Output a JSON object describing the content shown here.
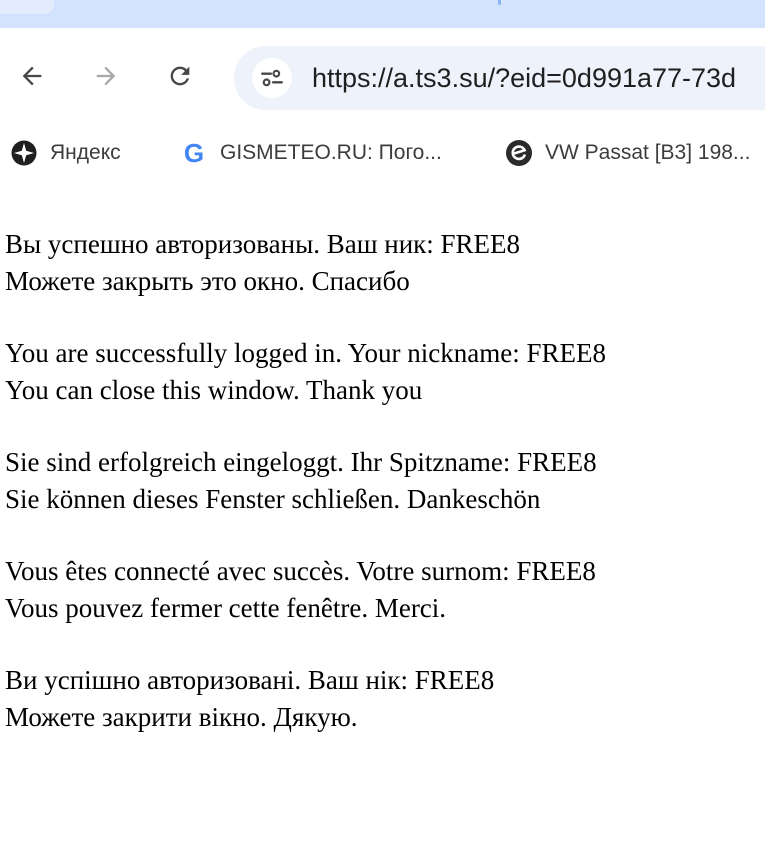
{
  "browser": {
    "url": "https://a.ts3.su/?eid=0d991a77-73d",
    "icons": {
      "back": "back-arrow-icon",
      "forward": "forward-arrow-icon",
      "reload": "reload-icon",
      "site_info": "site-settings-icon"
    },
    "colors": {
      "tabstrip": "#d3e3fd",
      "omnibox": "#eef2fa"
    }
  },
  "bookmarks": [
    {
      "label": "Яндекс",
      "icon": "yandex-icon"
    },
    {
      "label": "GISMETEO.RU: Пого...",
      "icon": "google-g-icon"
    },
    {
      "label": "VW Passat [B3] 198...",
      "icon": "drive2-icon"
    }
  ],
  "messages": [
    {
      "line1": "Вы успешно авторизованы. Ваш ник: FREE8",
      "line2": "Можете закрыть это окно. Спасибо"
    },
    {
      "line1": "You are successfully logged in. Your nickname: FREE8",
      "line2": "You can close this window. Thank you"
    },
    {
      "line1": "Sie sind erfolgreich eingeloggt. Ihr Spitzname: FREE8",
      "line2": "Sie können dieses Fenster schließen. Dankeschön"
    },
    {
      "line1": "Vous êtes connecté avec succès. Votre surnom: FREE8",
      "line2": "Vous pouvez fermer cette fenêtre. Merci."
    },
    {
      "line1": "Ви успішно авторизовані. Ваш нік: FREE8",
      "line2": "Можете закрити вікно. Дякую."
    }
  ]
}
